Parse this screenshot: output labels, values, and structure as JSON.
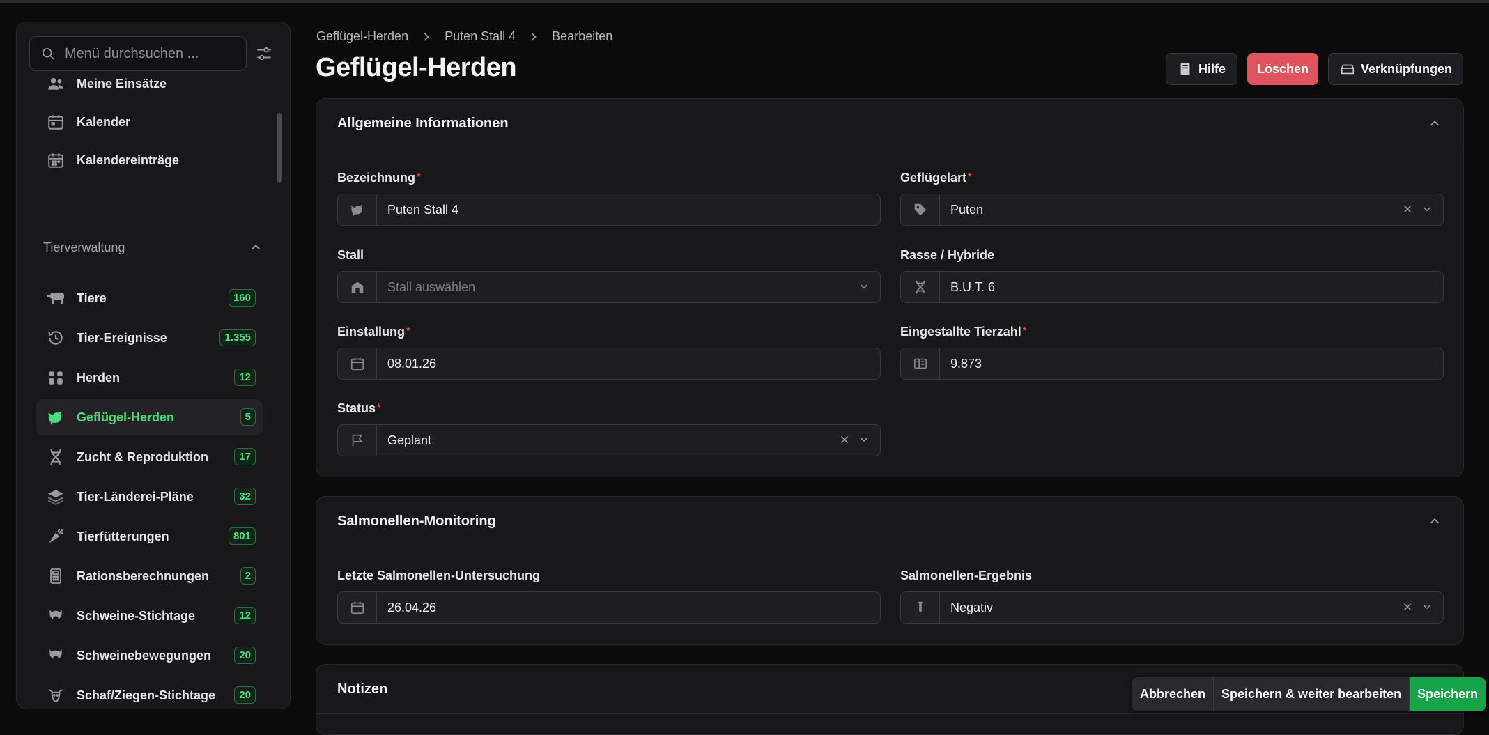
{
  "sidebar": {
    "search_placeholder": "Menü durchsuchen ...",
    "items_top": [
      {
        "label": "Meine Einsätze",
        "icon": "users-icon"
      },
      {
        "label": "Kalender",
        "icon": "calendar-icon"
      },
      {
        "label": "Kalendereinträge",
        "icon": "calendar-entries-icon"
      }
    ],
    "group_label": "Tierverwaltung",
    "items": [
      {
        "label": "Tiere",
        "badge": "160",
        "icon": "cow-icon"
      },
      {
        "label": "Tier-Ereignisse",
        "badge": "1.355",
        "icon": "history-icon"
      },
      {
        "label": "Herden",
        "badge": "12",
        "icon": "herd-icon"
      },
      {
        "label": "Geflügel-Herden",
        "badge": "5",
        "icon": "bird-icon",
        "active": true
      },
      {
        "label": "Zucht & Reproduktion",
        "badge": "17",
        "icon": "dna-icon"
      },
      {
        "label": "Tier-Länderei-Pläne",
        "badge": "32",
        "icon": "layers-icon"
      },
      {
        "label": "Tierfütterungen",
        "badge": "801",
        "icon": "carrot-icon"
      },
      {
        "label": "Rationsberechnungen",
        "badge": "2",
        "icon": "calculator-icon"
      },
      {
        "label": "Schweine-Stichtage",
        "badge": "12",
        "icon": "pig-icon"
      },
      {
        "label": "Schweinebewegungen",
        "badge": "20",
        "icon": "pig-icon"
      },
      {
        "label": "Schaf/Ziegen-Stichtage",
        "badge": "20",
        "icon": "goat-icon"
      }
    ]
  },
  "header": {
    "breadcrumb": [
      "Geflügel-Herden",
      "Puten Stall 4",
      "Bearbeiten"
    ],
    "title": "Geflügel-Herden",
    "help_label": "Hilfe",
    "delete_label": "Löschen",
    "links_label": "Verknüpfungen"
  },
  "general": {
    "title": "Allgemeine Informationen",
    "bezeichnung_label": "Bezeichnung",
    "bezeichnung_value": "Puten Stall 4",
    "gefluegelart_label": "Geflügelart",
    "gefluegelart_value": "Puten",
    "stall_label": "Stall",
    "stall_placeholder": "Stall auswählen",
    "rasse_label": "Rasse / Hybride",
    "rasse_value": "B.U.T. 6",
    "einstallung_label": "Einstallung",
    "einstallung_value": "08.01.26",
    "tierzahl_label": "Eingestallte Tierzahl",
    "tierzahl_value": "9.873",
    "status_label": "Status",
    "status_value": "Geplant"
  },
  "salmonella": {
    "title": "Salmonellen-Monitoring",
    "date_label": "Letzte Salmonellen-Untersuchung",
    "date_value": "26.04.26",
    "result_label": "Salmonellen-Ergebnis",
    "result_value": "Negativ"
  },
  "notes": {
    "title": "Notizen"
  },
  "footer": {
    "cancel_label": "Abbrechen",
    "save_continue_label": "Speichern & weiter bearbeiten",
    "save_label": "Speichern"
  },
  "colors": {
    "accent": "#4ade80",
    "danger": "#e0525e",
    "save": "#16a34a"
  }
}
